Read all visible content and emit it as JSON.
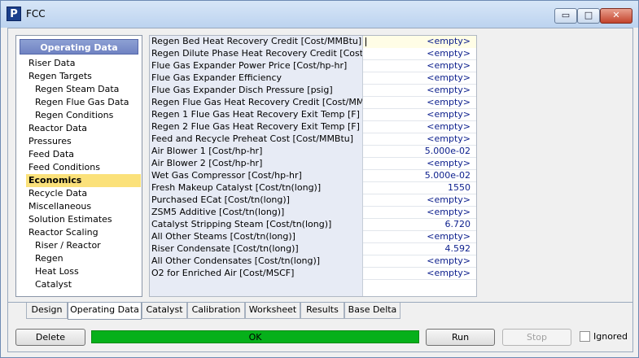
{
  "window": {
    "title": "FCC",
    "icon_letter": "P",
    "minimize_glyph": "▭",
    "maximize_glyph": "□",
    "close_glyph": "✕"
  },
  "nav": {
    "header": "Operating Data",
    "items": [
      {
        "label": "Riser Data",
        "level": 0,
        "selected": false
      },
      {
        "label": "Regen Targets",
        "level": 0,
        "selected": false
      },
      {
        "label": "Regen Steam Data",
        "level": 1,
        "selected": false
      },
      {
        "label": "Regen Flue Gas Data",
        "level": 1,
        "selected": false
      },
      {
        "label": "Regen Conditions",
        "level": 1,
        "selected": false
      },
      {
        "label": "Reactor Data",
        "level": 0,
        "selected": false
      },
      {
        "label": "Pressures",
        "level": 0,
        "selected": false
      },
      {
        "label": "Feed Data",
        "level": 0,
        "selected": false
      },
      {
        "label": "Feed Conditions",
        "level": 0,
        "selected": false
      },
      {
        "label": "Economics",
        "level": 0,
        "selected": true
      },
      {
        "label": "Recycle Data",
        "level": 0,
        "selected": false
      },
      {
        "label": "Miscellaneous",
        "level": 0,
        "selected": false
      },
      {
        "label": "Solution Estimates",
        "level": 0,
        "selected": false
      },
      {
        "label": "Reactor Scaling",
        "level": 0,
        "selected": false
      },
      {
        "label": "Riser / Reactor",
        "level": 1,
        "selected": false
      },
      {
        "label": "Regen",
        "level": 1,
        "selected": false
      },
      {
        "label": "Heat Loss",
        "level": 1,
        "selected": false
      },
      {
        "label": "Catalyst",
        "level": 1,
        "selected": false
      }
    ]
  },
  "grid": {
    "rows": [
      {
        "label": "Regen Bed Heat Recovery Credit [Cost/MMBtu]",
        "value": "<empty>"
      },
      {
        "label": "Regen Dilute Phase Heat Recovery Credit [Cost/MM",
        "value": "<empty>"
      },
      {
        "label": "Flue Gas Expander Power Price [Cost/hp-hr]",
        "value": "<empty>"
      },
      {
        "label": "Flue Gas Expander Efficiency",
        "value": "<empty>"
      },
      {
        "label": "Flue Gas Expander Disch Pressure [psig]",
        "value": "<empty>"
      },
      {
        "label": "Regen Flue Gas Heat Recovery Credit [Cost/MMBtu]",
        "value": "<empty>"
      },
      {
        "label": "Regen 1 Flue Gas Heat Recovery Exit Temp [F]",
        "value": "<empty>"
      },
      {
        "label": "Regen 2 Flue Gas Heat Recovery Exit Temp [F]",
        "value": "<empty>"
      },
      {
        "label": "Feed and Recycle Preheat Cost [Cost/MMBtu]",
        "value": "<empty>"
      },
      {
        "label": "Air Blower 1 [Cost/hp-hr]",
        "value": "5.000e-02"
      },
      {
        "label": "Air Blower 2 [Cost/hp-hr]",
        "value": "<empty>"
      },
      {
        "label": "Wet Gas Compressor [Cost/hp-hr]",
        "value": "5.000e-02"
      },
      {
        "label": "Fresh Makeup Catalyst [Cost/tn(long)]",
        "value": "1550"
      },
      {
        "label": "Purchased ECat [Cost/tn(long)]",
        "value": "<empty>"
      },
      {
        "label": "ZSM5 Additive [Cost/tn(long)]",
        "value": "<empty>"
      },
      {
        "label": "Catalyst Stripping Steam [Cost/tn(long)]",
        "value": "6.720"
      },
      {
        "label": "All Other Steams [Cost/tn(long)]",
        "value": "<empty>"
      },
      {
        "label": "Riser Condensate [Cost/tn(long)]",
        "value": "4.592"
      },
      {
        "label": "All Other Condensates [Cost/tn(long)]",
        "value": "<empty>"
      },
      {
        "label": "O2 for Enriched Air [Cost/MSCF]",
        "value": "<empty>"
      }
    ]
  },
  "tabs": [
    {
      "label": "Design",
      "active": false
    },
    {
      "label": "Operating Data",
      "active": true
    },
    {
      "label": "Catalyst",
      "active": false
    },
    {
      "label": "Calibration",
      "active": false
    },
    {
      "label": "Worksheet",
      "active": false
    },
    {
      "label": "Results",
      "active": false
    },
    {
      "label": "Base Delta",
      "active": false
    }
  ],
  "footer": {
    "delete_label": "Delete",
    "status_text": "OK",
    "run_label": "Run",
    "stop_label": "Stop",
    "ignored_label": "Ignored",
    "ignored_checked": false
  },
  "colors": {
    "status_ok": "#06b01a",
    "selected_nav": "#fbe17a",
    "nav_header": "#7083c3",
    "value_text": "#0b1e8c"
  }
}
